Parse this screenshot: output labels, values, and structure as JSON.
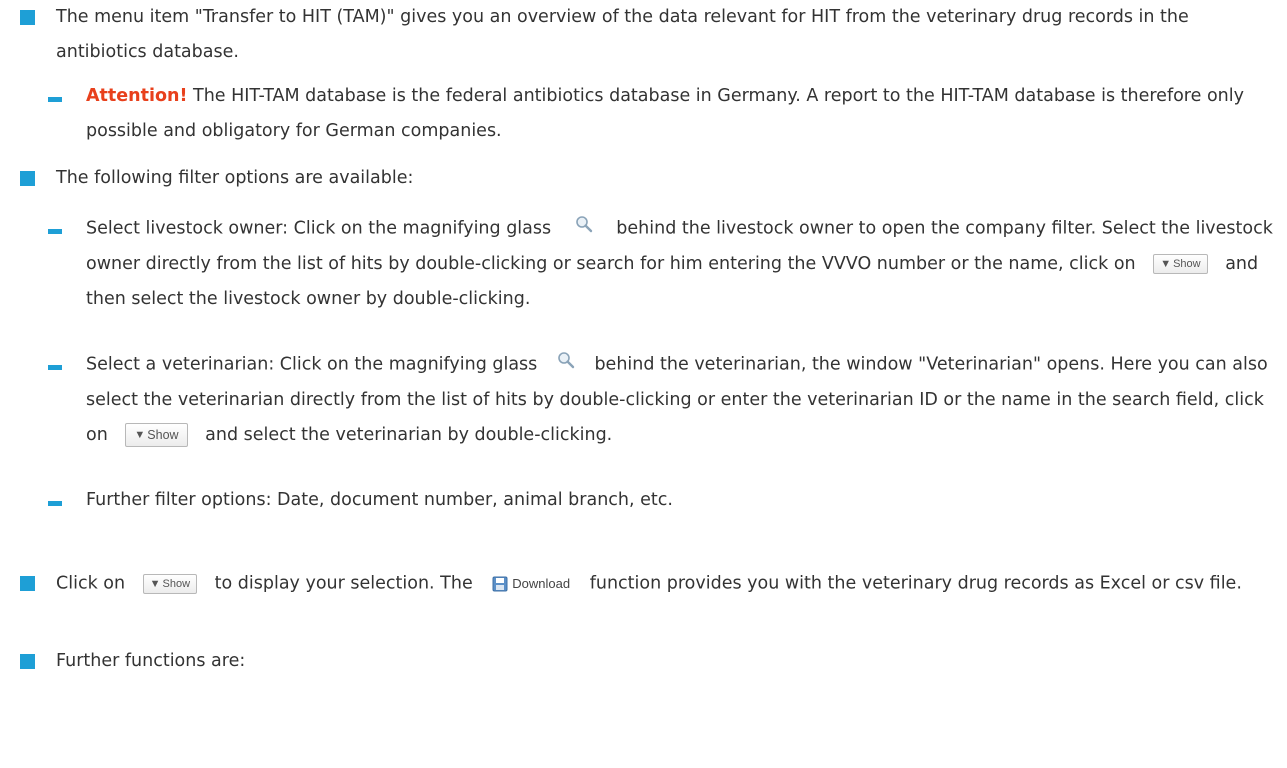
{
  "intro": {
    "text": "The menu item \"Transfer to HIT (TAM)\" gives you an overview of the data relevant for HIT from the veterinary drug records in the antibiotics database."
  },
  "attention": {
    "label": "Attention!",
    "text": " The HIT-TAM database is the federal antibiotics database in Germany. A report to the HIT-TAM database is therefore only possible and obligatory for German companies."
  },
  "filters": {
    "heading": "The following filter options are available:",
    "owner_part1": "Select livestock owner: Click on the magnifying glass",
    "owner_part2": "behind the livestock owner to open the company filter. Select the livestock owner directly from the list of hits by double-clicking or search for him entering the VVVO number or the name, click on",
    "owner_part3": "and then select the livestock owner by double-clicking.",
    "vet_part1": "Select a veterinarian: Click on the magnifying glass",
    "vet_part2": "behind the veterinarian, the window \"Veterinarian\" opens. Here you can also select the veterinarian directly from the list of hits by double-clicking or enter the veterinarian ID or the name in the search field, click on",
    "vet_part3": "and select the veterinarian by double-clicking.",
    "further": "Further filter options: Date, document number, animal branch, etc."
  },
  "display": {
    "part1": "Click on",
    "part2": "to display your selection. The",
    "part3": "function provides you with the veterinary drug records as Excel or csv file."
  },
  "buttons": {
    "show_label": "Show",
    "download_label": "Download"
  },
  "functions": {
    "heading": "Further functions are:"
  },
  "colors": {
    "bullet": "#1e9fd6",
    "attention": "#e8401c"
  }
}
